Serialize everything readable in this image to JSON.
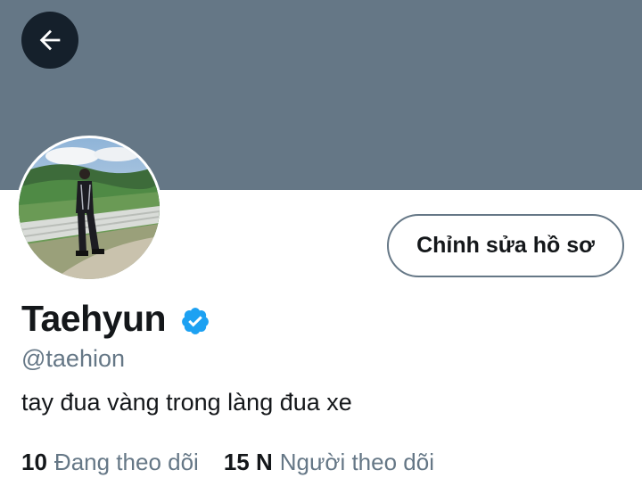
{
  "header": {
    "back_icon": "arrow-left-icon",
    "banner_color": "#657786"
  },
  "profile": {
    "edit_button_label": "Chỉnh sửa hồ sơ",
    "display_name": "Taehyun",
    "verified_icon": "verified-badge-icon",
    "verified_color": "#1da1f2",
    "handle": "@taehion",
    "bio": "tay đua vàng trong làng đua xe"
  },
  "stats": {
    "following_count": "10",
    "following_label": "Đang theo dõi",
    "followers_count": "15 N",
    "followers_label": "Người theo dõi"
  }
}
